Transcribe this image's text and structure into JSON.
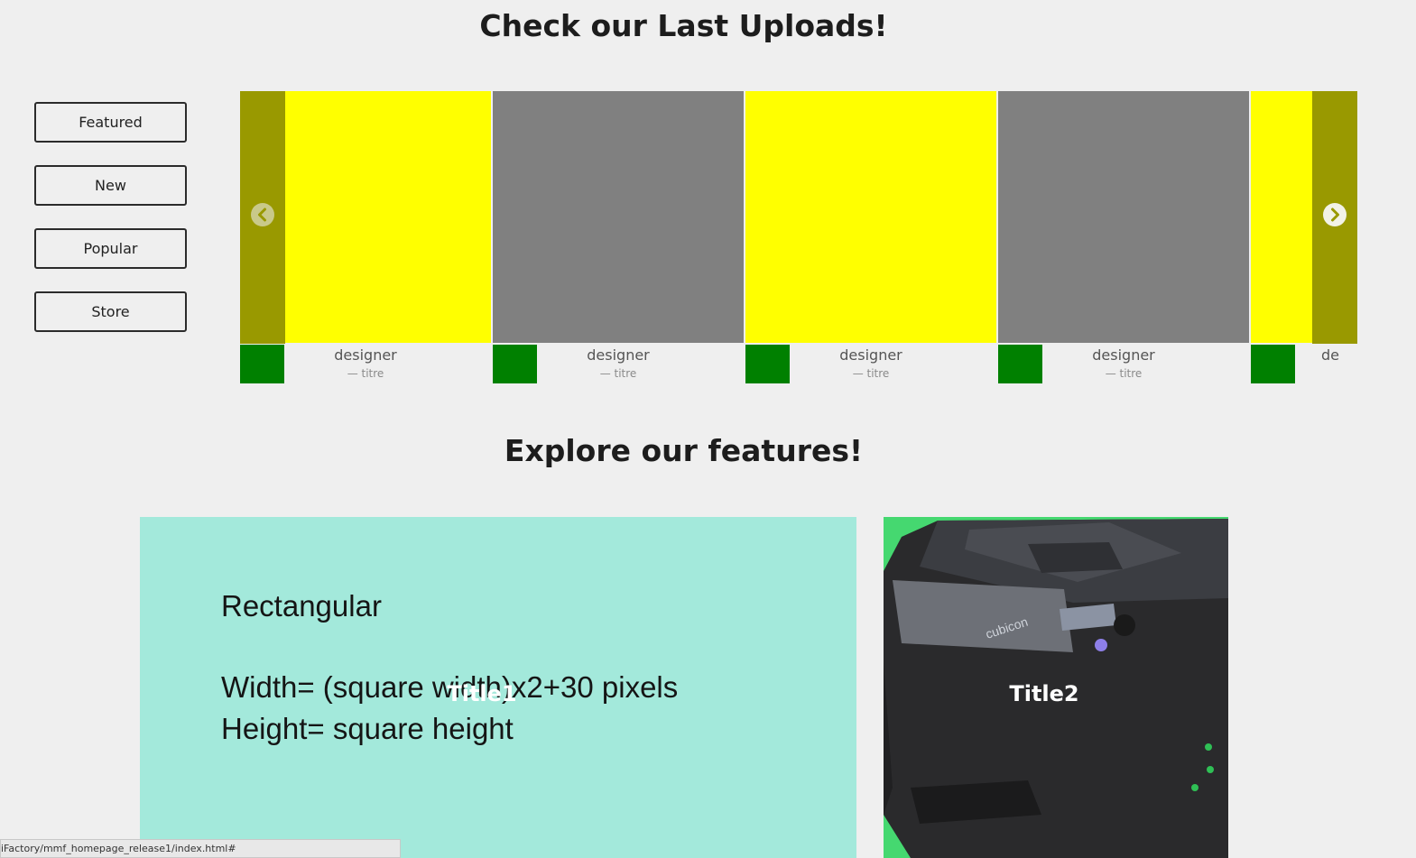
{
  "headings": {
    "uploads": "Check our Last Uploads!",
    "features": "Explore our features!"
  },
  "filters": [
    "Featured",
    "New",
    "Popular",
    "Store"
  ],
  "carousel": {
    "slides": [
      {
        "designer": "designer",
        "titre": "— titre",
        "color": "#ffff00"
      },
      {
        "designer": "designer",
        "titre": "— titre",
        "color": "#808080"
      },
      {
        "designer": "designer",
        "titre": "— titre",
        "color": "#ffff00"
      },
      {
        "designer": "designer",
        "titre": "— titre",
        "color": "#808080"
      },
      {
        "designer": "de",
        "titre": "",
        "color": "#ffff00"
      }
    ],
    "avatar_color": "#008000",
    "arrow_panel_color": "#999900"
  },
  "features": [
    {
      "title": "Title1",
      "bg": "#a3e9db",
      "lines": [
        "Rectangular",
        "Width= (square width)x2+30 pixels",
        "Height= square height"
      ]
    },
    {
      "title": "Title2",
      "bg": "#45d870"
    }
  ],
  "printer_label": "cubicon",
  "status_url": "iFactory/mmf_homepage_release1/index.html#"
}
